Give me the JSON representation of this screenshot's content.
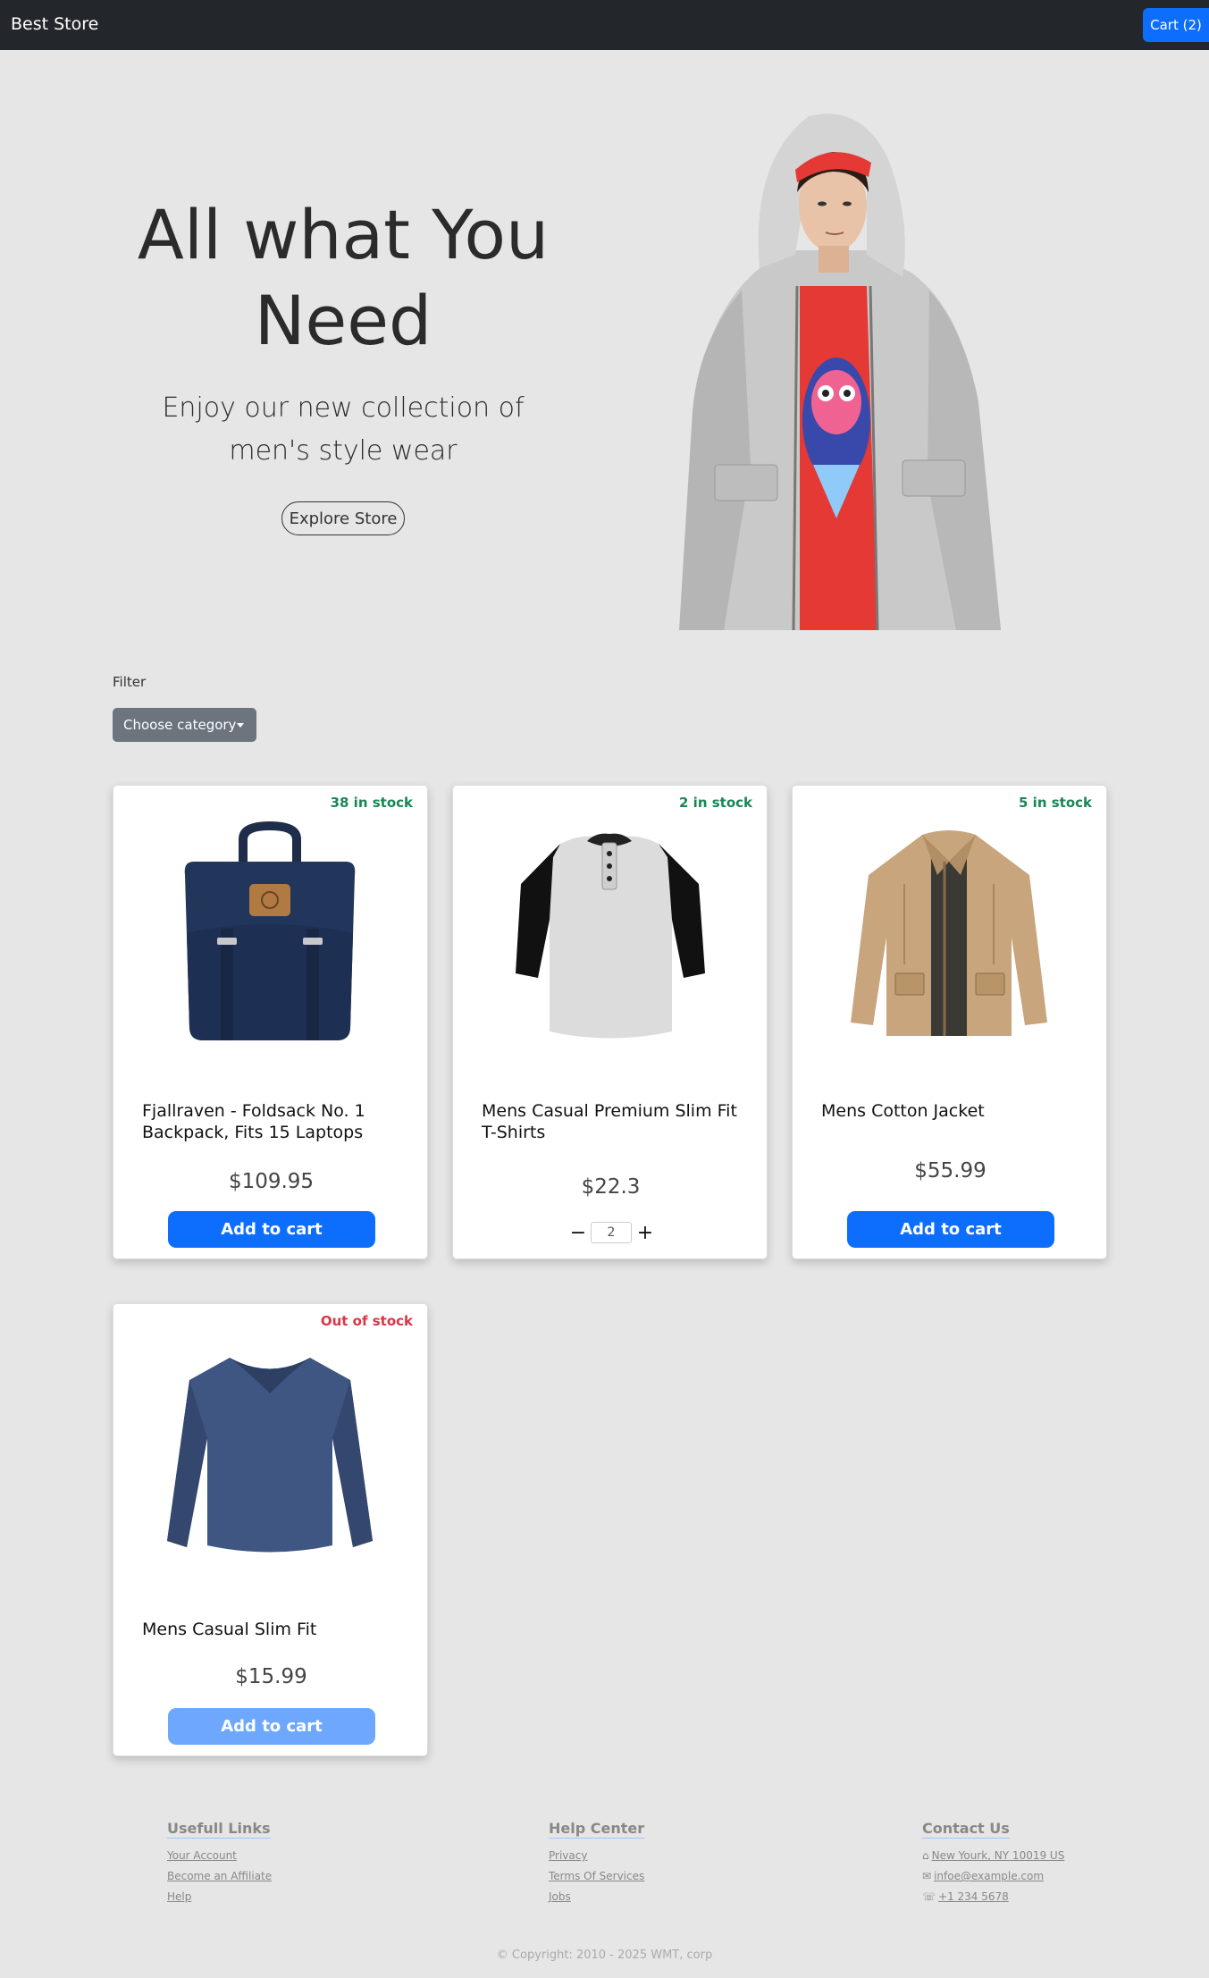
{
  "navbar": {
    "brand": "Best Store",
    "cart_label": "Cart (2)"
  },
  "hero": {
    "title": "All what You Need",
    "subtitle": "Enjoy our new collection of men's style wear",
    "explore_label": "Explore Store"
  },
  "filter": {
    "label": "Filter",
    "dropdown_label": "Choose category"
  },
  "products": [
    {
      "name": "Fjallraven - Foldsack No. 1 Backpack, Fits 15 Laptops",
      "price": "$109.95",
      "stock": "38 in stock",
      "action": "Add to cart"
    },
    {
      "name": "Mens Casual Premium Slim Fit T-Shirts",
      "price": "$22.3",
      "stock": "2 in stock",
      "quantity": "2"
    },
    {
      "name": "Mens Cotton Jacket",
      "price": "$55.99",
      "stock": "5 in stock",
      "action": "Add to cart"
    },
    {
      "name": "Mens Casual Slim Fit",
      "price": "$15.99",
      "stock": "Out of stock",
      "action": "Add to cart"
    }
  ],
  "footer": {
    "useful": {
      "heading": "Usefull Links",
      "links": [
        "Your Account",
        "Become an Affiliate",
        "Help"
      ]
    },
    "help": {
      "heading": "Help Center",
      "links": [
        "Privacy",
        "Terms Of Services",
        "Jobs"
      ]
    },
    "contact": {
      "heading": "Contact Us",
      "address": "New Yourk, NY 10019 US",
      "email": "infoe@example.com",
      "phone": "+1 234 5678"
    },
    "copyright": "© Copyright: 2010 - 2025 WMT, corp"
  },
  "colors": {
    "primary": "#0d6efd",
    "in_stock": "#198754",
    "out_of_stock": "#dc3545",
    "navbar": "#23272b",
    "page_bg": "#e6e6e6"
  }
}
